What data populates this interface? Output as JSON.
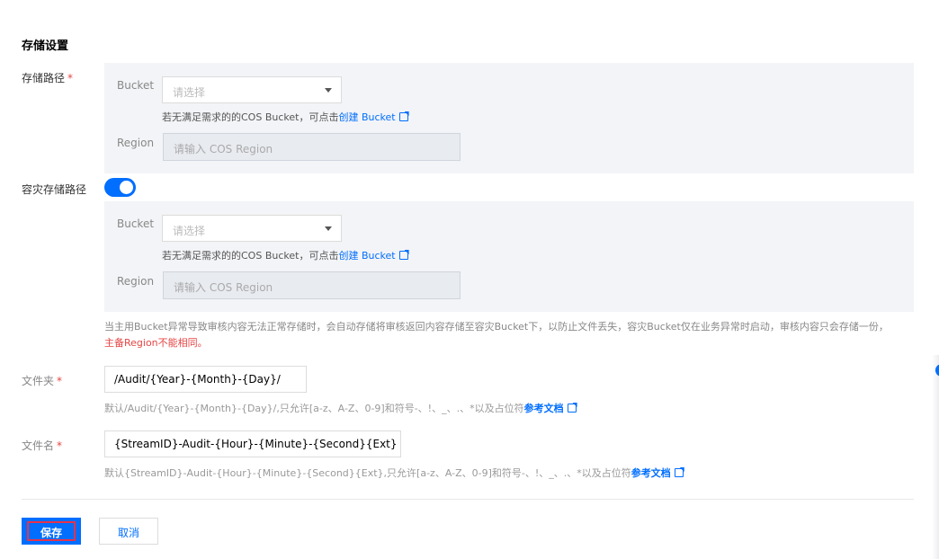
{
  "section_title": "存储设置",
  "storage_path": {
    "label": "存储路径",
    "required_mark": "*",
    "bucket_label": "Bucket",
    "bucket_placeholder": "请选择",
    "hint_prefix": "若无满足需求的的COS Bucket，可点击",
    "hint_link": "创建 Bucket",
    "region_label": "Region",
    "region_placeholder": "请输入 COS Region"
  },
  "dr_storage_path": {
    "label": "容灾存储路径",
    "toggle_on": true,
    "bucket_label": "Bucket",
    "bucket_placeholder": "请选择",
    "hint_prefix": "若无满足需求的的COS Bucket，可点击",
    "hint_link": "创建 Bucket",
    "region_label": "Region",
    "region_placeholder": "请输入 COS Region"
  },
  "dr_note": {
    "text": "当主用Bucket异常导致审核内容无法正常存储时，会自动存储将审核返回内容存储至容灾Bucket下，以防止文件丢失，容灾Bucket仅在业务异常时启动，审核内容只会存储一份，",
    "warning": "主备Region不能相同。"
  },
  "folder": {
    "label": "文件夹",
    "required_mark": "*",
    "value": "/Audit/{Year}-{Month}-{Day}/",
    "hint_prefix": "默认/Audit/{Year}-{Month}-{Day}/,只允许[a-z、A-Z、0-9]和符号-、!、_、.、*以及占位符",
    "hint_link": "参考文档"
  },
  "filename": {
    "label": "文件名",
    "required_mark": "*",
    "value": "{StreamID}-Audit-{Hour}-{Minute}-{Second}{Ext}",
    "hint_prefix": "默认{StreamID}-Audit-{Hour}-{Minute}-{Second}{Ext},只允许[a-z、A-Z、0-9]和符号-、!、_、.、*以及占位符",
    "hint_link": "参考文档"
  },
  "buttons": {
    "save": "保存",
    "cancel": "取消"
  },
  "colors": {
    "primary": "#006eff",
    "danger": "#e54545",
    "panel_bg": "#f3f4f7"
  }
}
